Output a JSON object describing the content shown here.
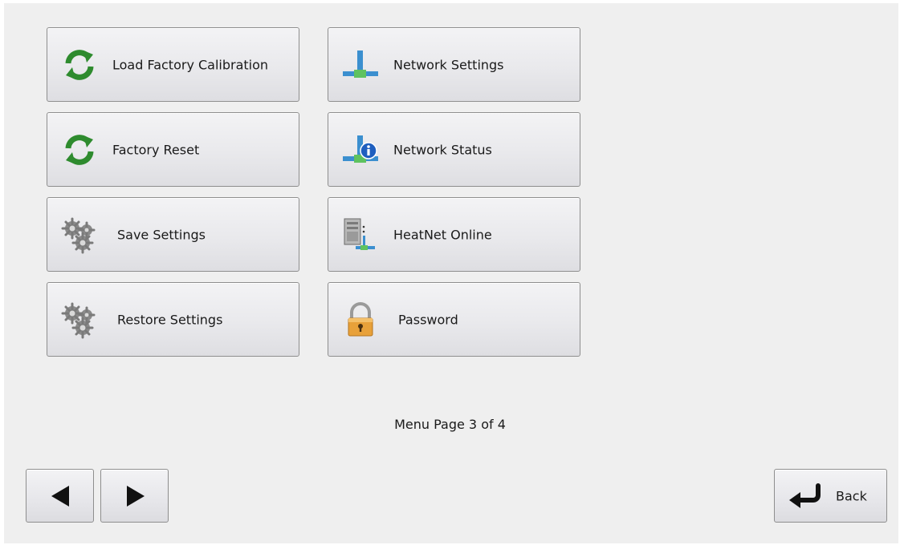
{
  "menu": {
    "items": [
      {
        "id": "load-factory-calibration",
        "label": "Load Factory Calibration",
        "icon": "refresh-icon"
      },
      {
        "id": "factory-reset",
        "label": "Factory Reset",
        "icon": "refresh-icon"
      },
      {
        "id": "save-settings",
        "label": "Save Settings",
        "icon": "gears-icon"
      },
      {
        "id": "restore-settings",
        "label": "Restore Settings",
        "icon": "gears-icon"
      },
      {
        "id": "network-settings",
        "label": "Network Settings",
        "icon": "network-pipe-icon"
      },
      {
        "id": "network-status",
        "label": "Network Status",
        "icon": "network-info-icon"
      },
      {
        "id": "heatnet-online",
        "label": "HeatNet Online",
        "icon": "server-network-icon"
      },
      {
        "id": "password",
        "label": "Password",
        "icon": "padlock-icon"
      }
    ]
  },
  "pager": {
    "text": "Menu Page 3 of 4",
    "current_page": 3,
    "total_pages": 4
  },
  "nav": {
    "prev_icon": "left-triangle-icon",
    "next_icon": "right-triangle-icon",
    "back_label": "Back",
    "back_icon": "return-arrow-icon"
  },
  "colors": {
    "background": "#efefef",
    "refresh_green": "#2e8b2e",
    "pipe_blue": "#3b8fcf",
    "pipe_green": "#5fc25f",
    "info_blue": "#1f5fbf",
    "lock_orange": "#e8a13a"
  }
}
